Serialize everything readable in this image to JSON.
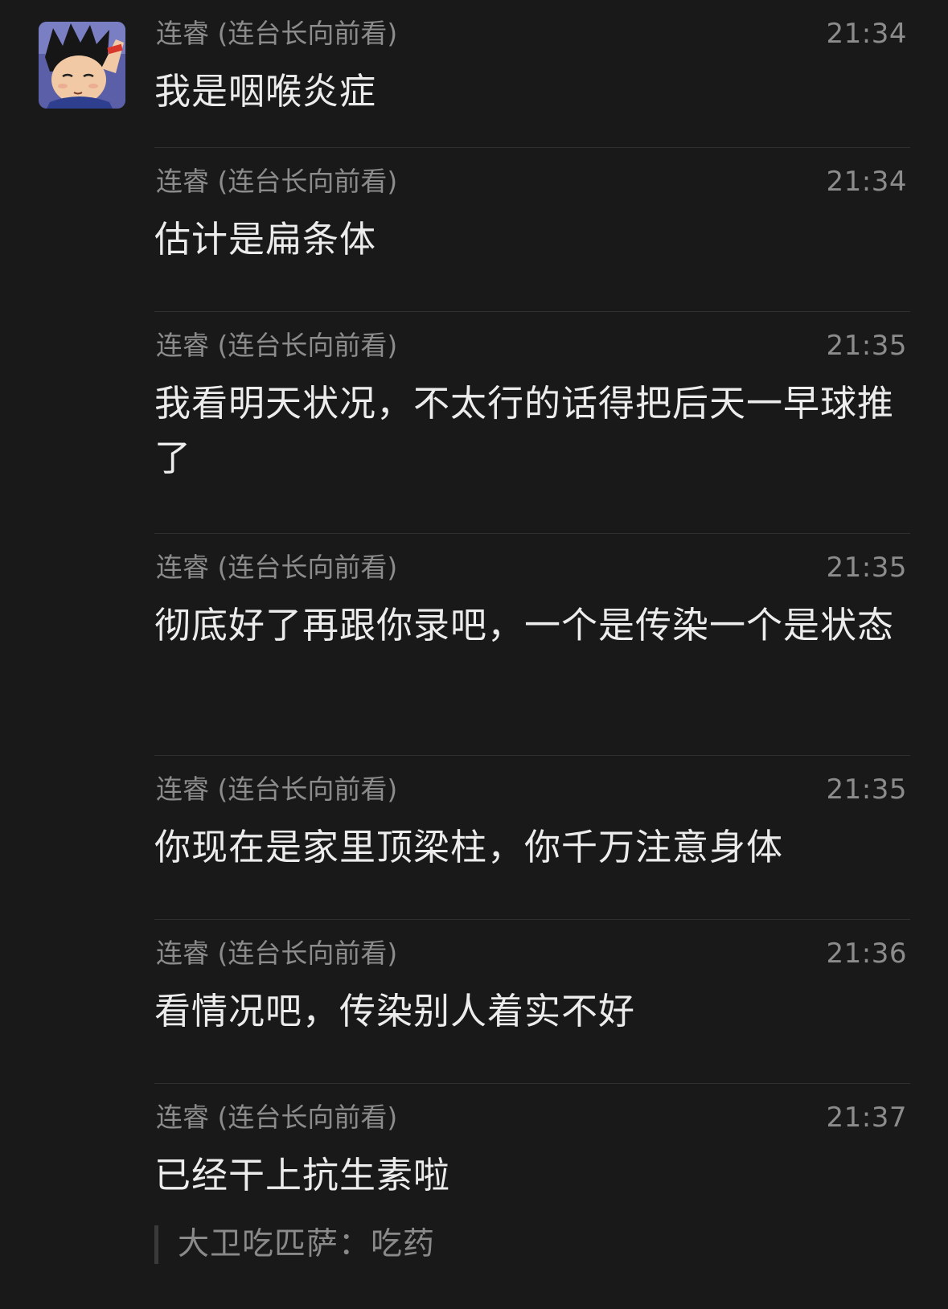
{
  "chat": {
    "messages": [
      {
        "sender": "连睿 (连台长向前看)",
        "time": "21:34",
        "text": "我是咽喉炎症"
      },
      {
        "sender": "连睿 (连台长向前看)",
        "time": "21:34",
        "text": "估计是扁条体"
      },
      {
        "sender": "连睿 (连台长向前看)",
        "time": "21:35",
        "text": "我看明天状况，不太行的话得把后天一早球推了"
      },
      {
        "sender": "连睿 (连台长向前看)",
        "time": "21:35",
        "text": "彻底好了再跟你录吧，一个是传染一个是状态"
      },
      {
        "sender": "连睿 (连台长向前看)",
        "time": "21:35",
        "text": "你现在是家里顶梁柱，你千万注意身体"
      },
      {
        "sender": "连睿 (连台长向前看)",
        "time": "21:36",
        "text": "看情况吧，传染别人着实不好"
      },
      {
        "sender": "连睿 (连台长向前看)",
        "time": "21:37",
        "text": "已经干上抗生素啦"
      }
    ],
    "quote": "大卫吃匹萨：吃药"
  },
  "avatar": {
    "icon": "cartoon-boy-avatar-icon"
  },
  "colors": {
    "background": "#191919",
    "meta_text": "#8c8c8c",
    "message_text": "#ececec",
    "divider": "#2f2f2f"
  }
}
